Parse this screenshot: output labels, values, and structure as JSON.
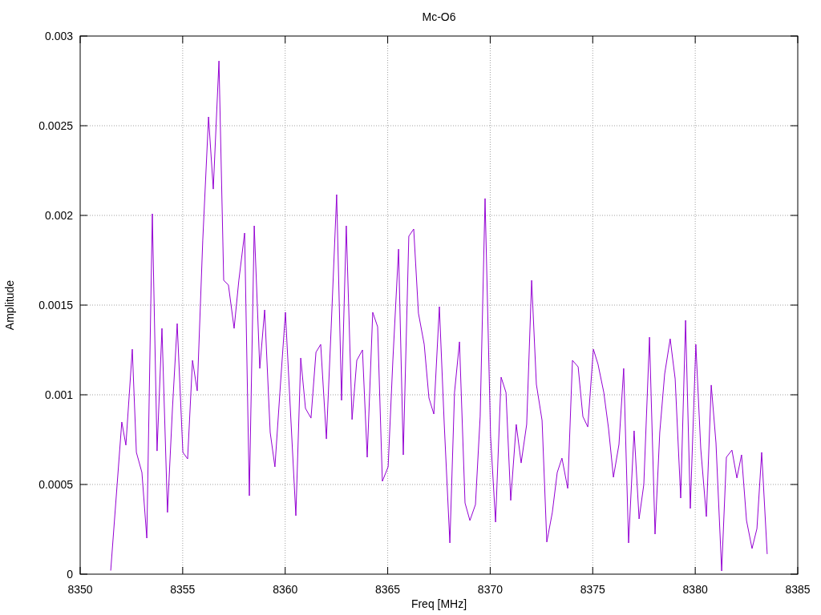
{
  "chart": {
    "chart_data": {
      "type": "line",
      "title": "Mc-O6",
      "xlabel": "Freq [MHz]",
      "ylabel": "Amplitude",
      "x": [
        8351.49,
        8352.03,
        8352.23,
        8352.54,
        8352.74,
        8353.01,
        8353.25,
        8353.52,
        8353.75,
        8353.99,
        8354.26,
        8354.5,
        8354.73,
        8355.01,
        8355.24,
        8355.48,
        8355.71,
        8355.98,
        8356.26,
        8356.49,
        8356.77,
        8357.0,
        8357.23,
        8357.51,
        8357.74,
        8358.02,
        8358.25,
        8358.49,
        8358.76,
        8359.0,
        8359.27,
        8359.5,
        8359.74,
        8360.01,
        8360.25,
        8360.52,
        8360.76,
        8360.99,
        8361.26,
        8361.5,
        8361.73,
        8362.01,
        8362.24,
        8362.51,
        8362.75,
        8362.98,
        8363.26,
        8363.49,
        8363.77,
        8364.0,
        8364.27,
        8364.51,
        8364.74,
        8365.02,
        8365.25,
        8365.53,
        8365.76,
        8366.03,
        8366.27,
        8366.5,
        8366.78,
        8367.01,
        8367.25,
        8367.52,
        8367.76,
        8368.03,
        8368.26,
        8368.5,
        8368.77,
        8369.01,
        8369.28,
        8369.51,
        8369.75,
        8370.02,
        8370.26,
        8370.53,
        8370.77,
        8371.0,
        8371.27,
        8371.51,
        8371.78,
        8372.02,
        8372.25,
        8372.53,
        8372.76,
        8373.03,
        8373.27,
        8373.5,
        8373.78,
        8374.01,
        8374.29,
        8374.52,
        8374.76,
        8375.03,
        8375.26,
        8375.54,
        8375.77,
        8376.01,
        8376.28,
        8376.51,
        8376.75,
        8377.02,
        8377.26,
        8377.49,
        8377.77,
        8378.04,
        8378.27,
        8378.51,
        8378.78,
        8379.02,
        8379.29,
        8379.53,
        8379.76,
        8380.03,
        8380.27,
        8380.54,
        8380.78,
        8381.01,
        8381.29,
        8381.52,
        8381.79,
        8382.03,
        8382.26,
        8382.5,
        8382.77,
        8383.01,
        8383.24,
        8383.51
      ],
      "series": [
        {
          "color": "#9400d3",
          "values": [
            2e-05,
            0.000848,
            0.000719,
            0.001254,
            0.000679,
            0.000567,
            0.000201,
            0.002009,
            0.000687,
            0.00137,
            0.000344,
            0.000924,
            0.001397,
            0.000679,
            0.000643,
            0.001192,
            0.001022,
            0.001861,
            0.002549,
            0.002147,
            0.002861,
            0.001638,
            0.001612,
            0.00137,
            0.001638,
            0.001902,
            0.000437,
            0.001942,
            0.001147,
            0.001473,
            0.00079,
            0.000598,
            0.001013,
            0.00146,
            0.000924,
            0.000326,
            0.001205,
            0.000924,
            0.00087,
            0.001237,
            0.001281,
            0.000754,
            0.00137,
            0.002116,
            0.000969,
            0.001942,
            0.000862,
            0.001192,
            0.00125,
            0.000652,
            0.00146,
            0.001379,
            0.000518,
            0.000598,
            0.001192,
            0.001812,
            0.000665,
            0.001884,
            0.001924,
            0.001455,
            0.001281,
            0.000982,
            0.000893,
            0.001491,
            0.000835,
            0.000174,
            0.001013,
            0.001295,
            0.000397,
            0.000299,
            0.000388,
            0.000879,
            0.002094,
            0.000768,
            0.00029,
            0.001098,
            0.001013,
            0.000411,
            0.000835,
            0.00062,
            0.000835,
            0.001638,
            0.001058,
            0.000857,
            0.000179,
            0.000344,
            0.000567,
            0.000647,
            0.000478,
            0.001192,
            0.001156,
            0.000879,
            0.000821,
            0.001254,
            0.00117,
            0.001013,
            0.000812,
            0.00054,
            0.000723,
            0.001147,
            0.000174,
            0.000799,
            0.000308,
            0.0005,
            0.001321,
            0.000223,
            0.00079,
            0.001116,
            0.001312,
            0.001089,
            0.000424,
            0.001415,
            0.000366,
            0.001281,
            0.000701,
            0.000321,
            0.001054,
            0.000732,
            1.8e-05,
            0.000652,
            0.000692,
            0.000536,
            0.000665,
            0.000299,
            0.000143,
            0.000254,
            0.000679,
            0.000112
          ]
        }
      ],
      "xlim": [
        8350,
        8385
      ],
      "ylim": [
        0,
        0.003
      ],
      "grid": true,
      "xticks": [
        8350,
        8355,
        8360,
        8365,
        8370,
        8375,
        8380,
        8385
      ],
      "yticks": [
        0,
        0.0005,
        0.001,
        0.0015,
        0.002,
        0.0025,
        0.003
      ]
    }
  }
}
